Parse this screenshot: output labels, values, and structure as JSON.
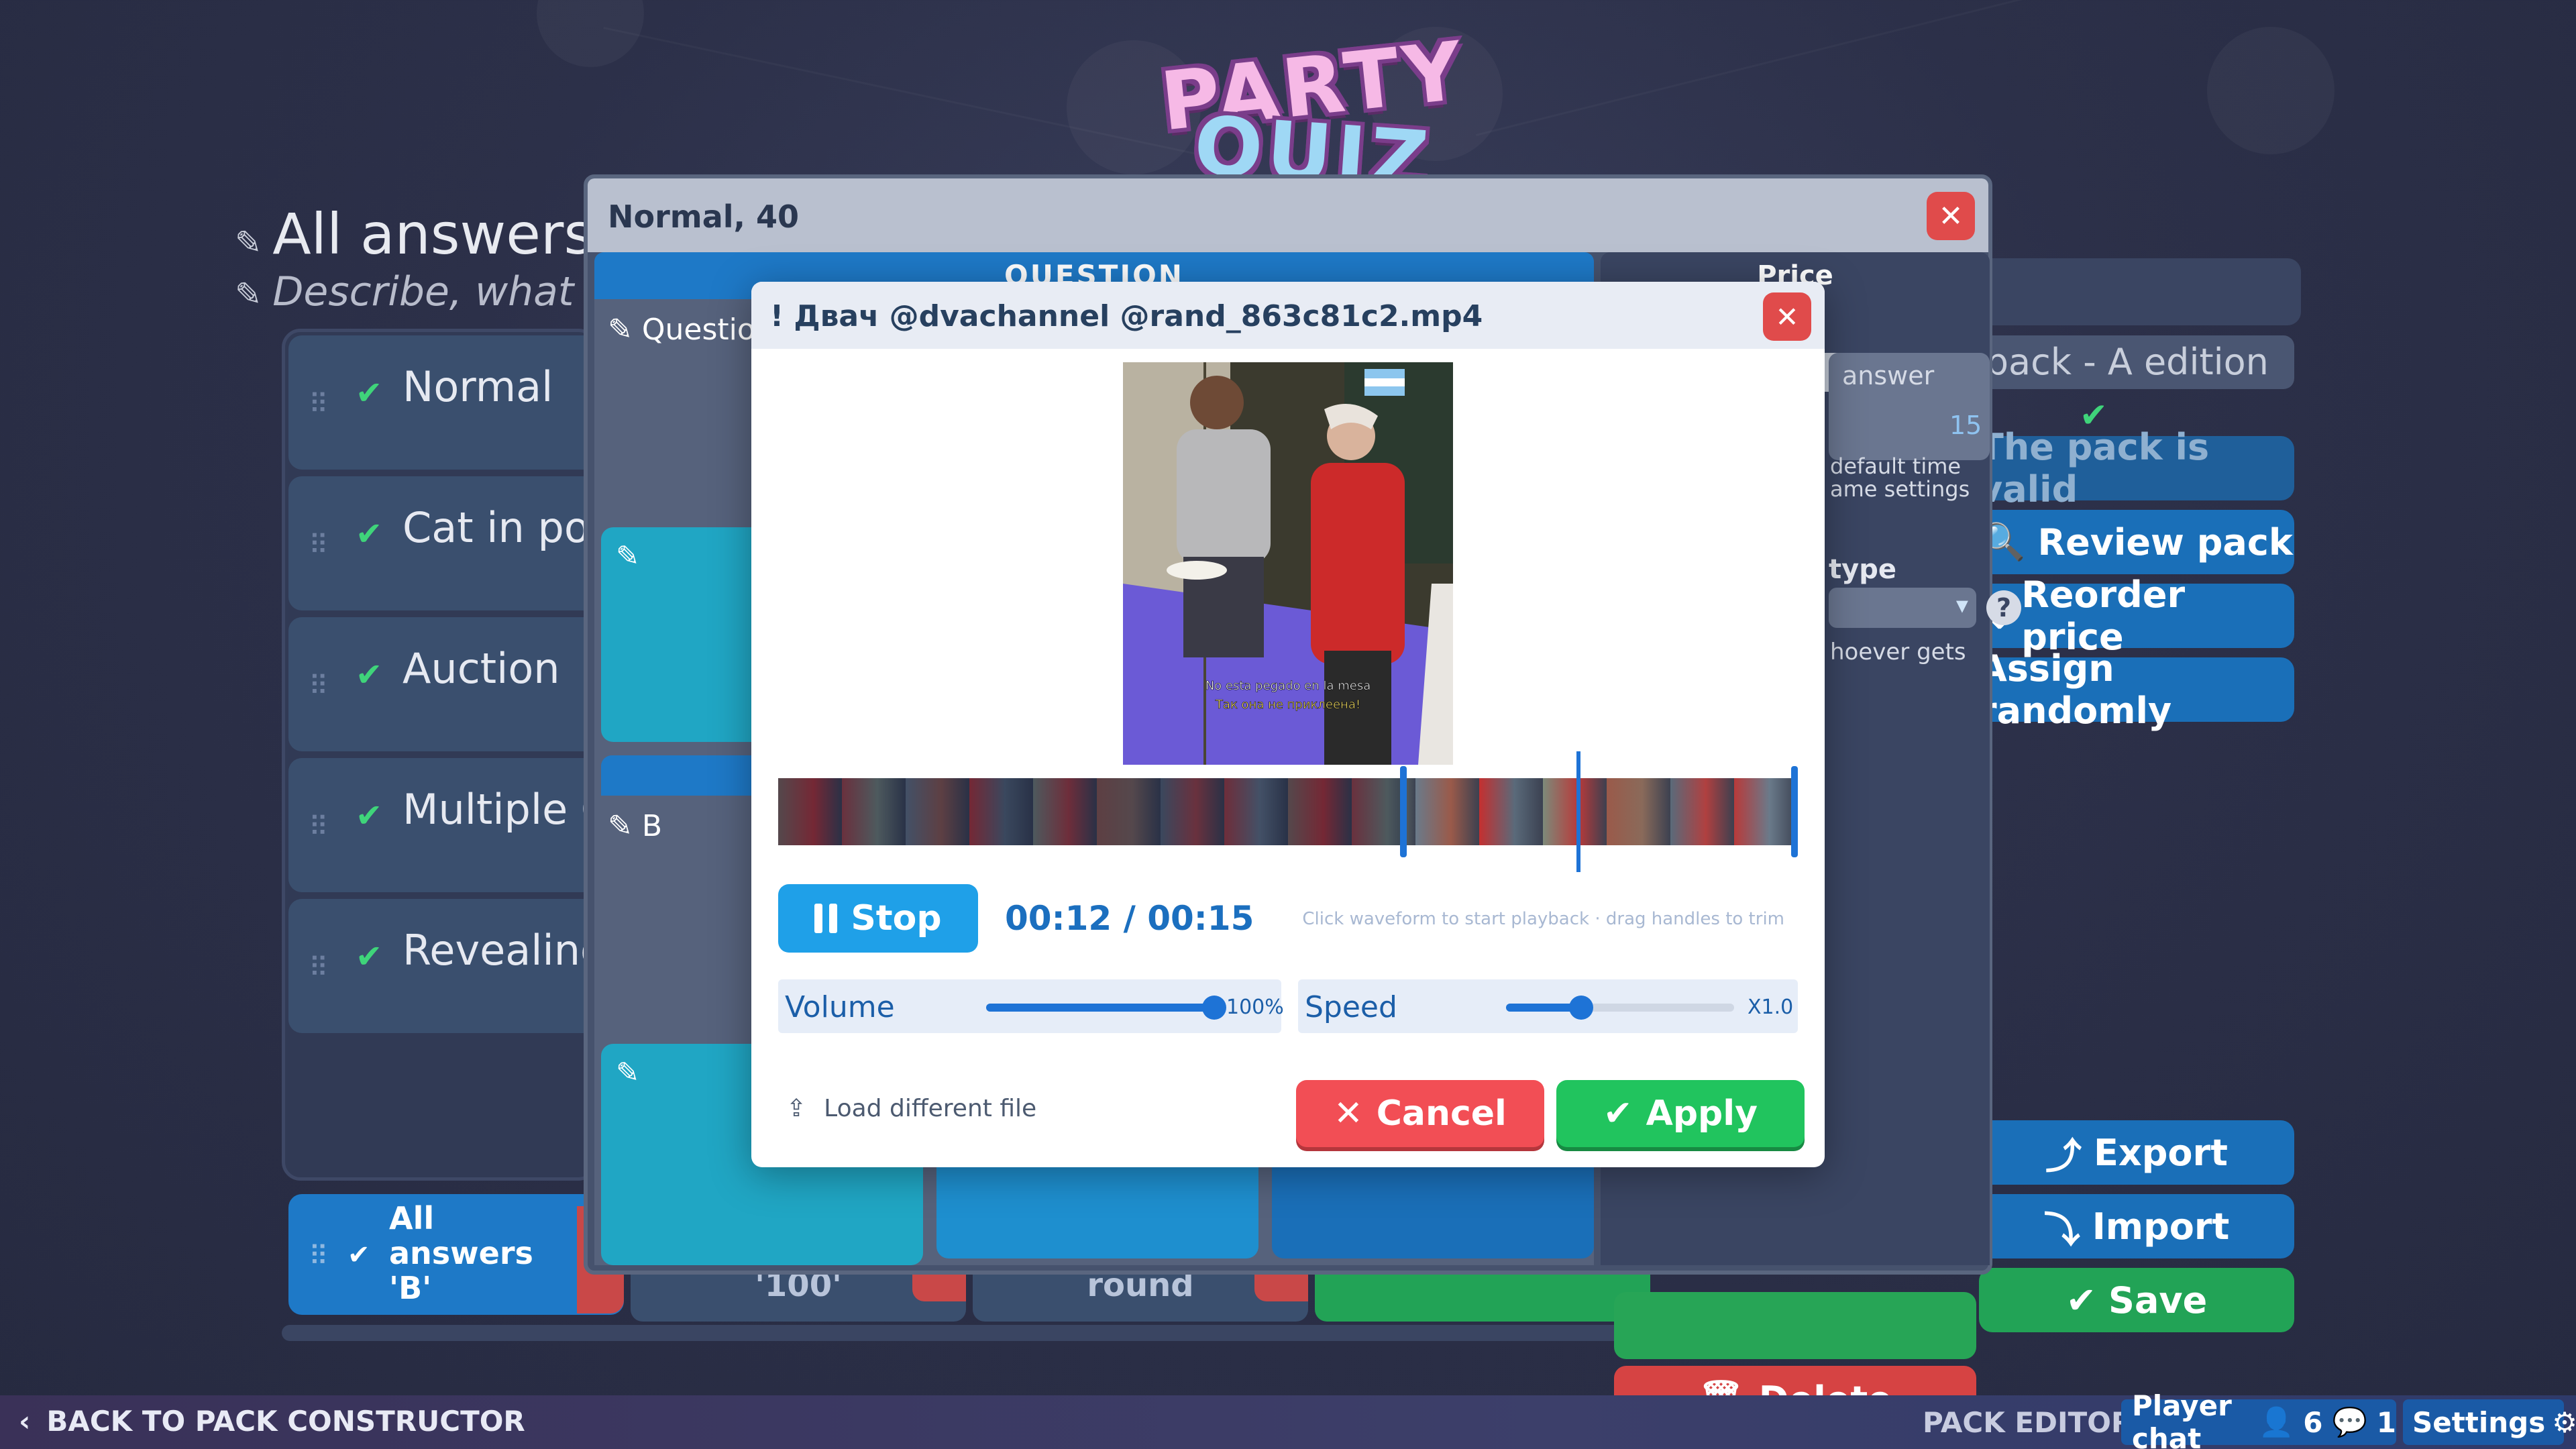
{
  "logo": {
    "line1": "PARTY",
    "line2": "QUIZ"
  },
  "background": {
    "round_title": "All answers",
    "round_desc": "Describe, what t",
    "rounds": [
      {
        "label": "Normal"
      },
      {
        "label": "Cat in pok"
      },
      {
        "label": "Auction"
      },
      {
        "label": "Multiple C"
      },
      {
        "label": "Revealing"
      }
    ],
    "bottom_round": {
      "label": "All answers 'B'"
    },
    "price_chips": [
      "'100'",
      "round"
    ],
    "pack_name": "est pack - A edition",
    "buttons": {
      "valid": "The pack is valid",
      "review": "Review pack",
      "reorder": "Reorder price",
      "assign": "Assign randomly",
      "export": "Export",
      "import": "Import",
      "save": "Save"
    }
  },
  "editor_modal": {
    "title": "Normal, 40",
    "tab_question": "QUESTION",
    "tab_price": "Price",
    "question_label": "Question",
    "answer_label": "B",
    "price_side": {
      "answer_label": "answer",
      "answer_value": "15",
      "default_time_1": "default time",
      "default_time_2": "ame settings",
      "type_label": "type",
      "whoever": "hoever gets",
      "delete": "Delete"
    }
  },
  "video_dialog": {
    "title": "! Двач @dvachannel @rand_863c81c2.mp4",
    "caption_1": "No esta pegado en la mesa",
    "caption_2": "Так она не приклеена!",
    "stop_label": "Stop",
    "time": "00:12 / 00:15",
    "hint": "Click waveform to start playback · drag handles to trim",
    "volume": {
      "label": "Volume",
      "value_text": "100%",
      "level": 1.0
    },
    "speed": {
      "label": "Speed",
      "value_text": "X1.0",
      "level": 0.33
    },
    "trim": {
      "start_fraction": 0.613,
      "end_fraction": 1.0,
      "playhead_fraction": 0.785
    },
    "load_label": "Load different file",
    "cancel_label": "Cancel",
    "apply_label": "Apply"
  },
  "bottombar": {
    "back": "BACK TO PACK CONSTRUCTOR",
    "pack_editor": "PACK EDITOR",
    "player_chat": "Player chat",
    "users_count": "6",
    "messages_count": "1",
    "settings": "Settings"
  },
  "colors": {
    "accent_blue": "#1e79c7",
    "green": "#21c45e",
    "red": "#f24e55",
    "background": "#2c3049"
  }
}
